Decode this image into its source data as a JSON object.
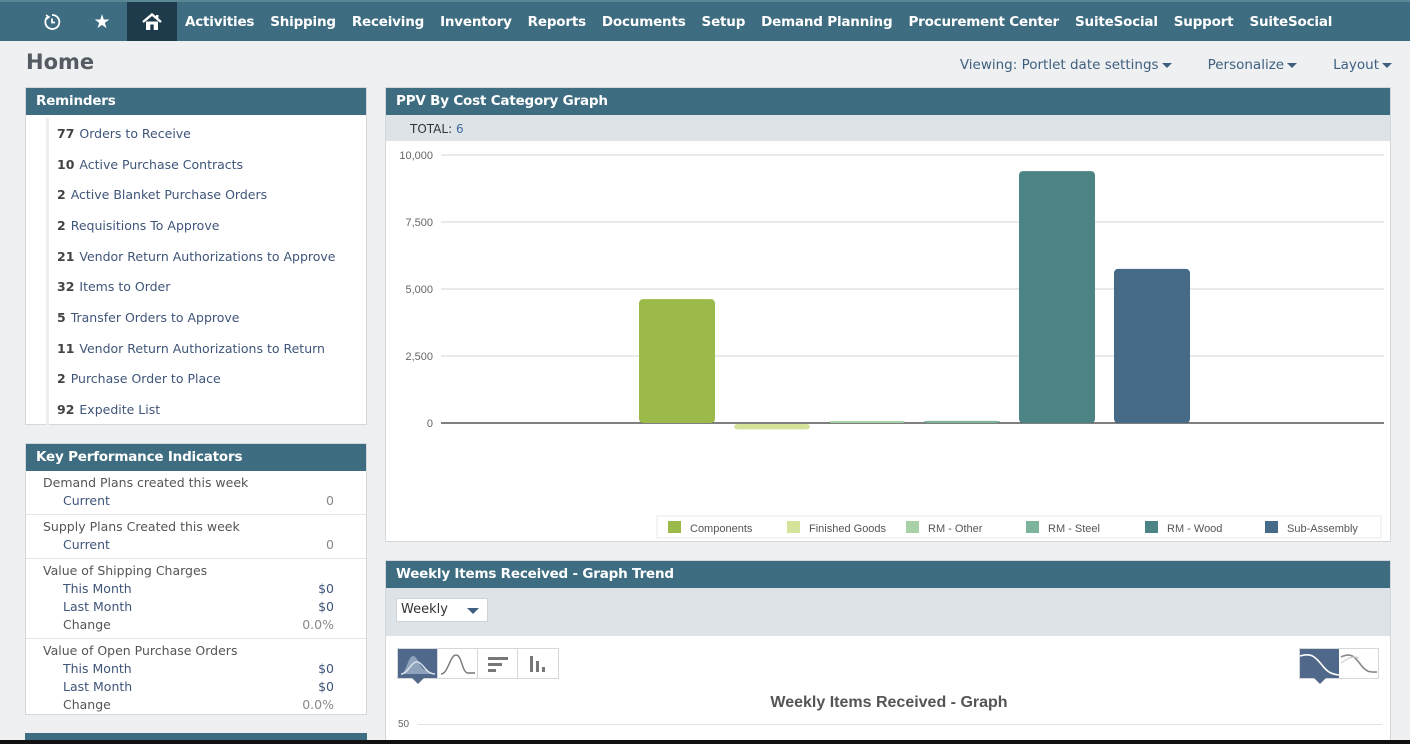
{
  "nav": {
    "icons": [
      "recent-icon",
      "star-icon",
      "home-icon"
    ],
    "items": [
      "Activities",
      "Shipping",
      "Receiving",
      "Inventory",
      "Reports",
      "Documents",
      "Setup",
      "Demand Planning",
      "Procurement Center",
      "SuiteSocial",
      "Support",
      "SuiteSocial"
    ]
  },
  "page": {
    "title": "Home",
    "actions": [
      "Viewing: Portlet date settings",
      "Personalize",
      "Layout"
    ]
  },
  "reminders": {
    "title": "Reminders",
    "items": [
      {
        "count": "77",
        "label": "Orders to Receive"
      },
      {
        "count": "10",
        "label": "Active Purchase Contracts"
      },
      {
        "count": "2",
        "label": "Active Blanket Purchase Orders"
      },
      {
        "count": "2",
        "label": "Requisitions To Approve"
      },
      {
        "count": "21",
        "label": "Vendor Return Authorizations to Approve"
      },
      {
        "count": "32",
        "label": "Items to Order"
      },
      {
        "count": "5",
        "label": "Transfer Orders to Approve"
      },
      {
        "count": "11",
        "label": "Vendor Return Authorizations to Return"
      },
      {
        "count": "2",
        "label": "Purchase Order to Place"
      },
      {
        "count": "92",
        "label": "Expedite List"
      }
    ]
  },
  "kpi": {
    "title": "Key Performance Indicators",
    "groups": [
      {
        "title": "Demand Plans created this week",
        "rows": [
          {
            "label": "Current",
            "value": "0"
          }
        ]
      },
      {
        "title": "Supply Plans Created this week",
        "rows": [
          {
            "label": "Current",
            "value": "0"
          }
        ]
      },
      {
        "title": "Value of Shipping Charges",
        "rows": [
          {
            "label": "This Month",
            "value": "$0"
          },
          {
            "label": "Last Month",
            "value": "$0"
          },
          {
            "label": "Change",
            "value": "0.0%"
          }
        ]
      },
      {
        "title": "Value of Open Purchase Orders",
        "rows": [
          {
            "label": "This Month",
            "value": "$0"
          },
          {
            "label": "Last Month",
            "value": "$0"
          },
          {
            "label": "Change",
            "value": "0.0%"
          }
        ]
      }
    ]
  },
  "ppv": {
    "title": "PPV By Cost Category Graph",
    "total_label": "TOTAL:",
    "total_value": "6"
  },
  "weekly": {
    "title": "Weekly Items Received - Graph Trend",
    "period_selected": "Weekly",
    "graph_title": "Weekly Items Received - Graph",
    "y_top_tick": "50",
    "chart_type_icons": [
      "area-chart-icon",
      "line-chart-icon",
      "horizontal-bar-icon",
      "column-chart-icon"
    ],
    "mode_icons": [
      "trend-filled-icon",
      "trend-line-icon"
    ]
  },
  "chart_data": [
    {
      "type": "bar",
      "title": "PPV By Cost Category Graph",
      "categories": [
        "Components",
        "Finished Goods",
        "RM - Other",
        "RM - Steel",
        "RM - Wood",
        "Sub-Assembly"
      ],
      "values": [
        4620,
        -200,
        60,
        80,
        9400,
        5750
      ],
      "colors": [
        "#9bba4a",
        "#d4e39a",
        "#a8d1a8",
        "#7db59c",
        "#4c8485",
        "#456b88"
      ],
      "yticks": [
        0,
        2500,
        5000,
        7500,
        10000
      ],
      "ytick_labels": [
        "0",
        "2,500",
        "5,000",
        "7,500",
        "10,000"
      ],
      "ylim": [
        0,
        10000
      ],
      "xlabel": "",
      "ylabel": "",
      "grid": true,
      "legend": "bottom-right"
    },
    {
      "type": "area",
      "title": "Weekly Items Received - Graph",
      "yticks": [
        50
      ],
      "ytick_labels": [
        "50"
      ],
      "series": []
    }
  ]
}
